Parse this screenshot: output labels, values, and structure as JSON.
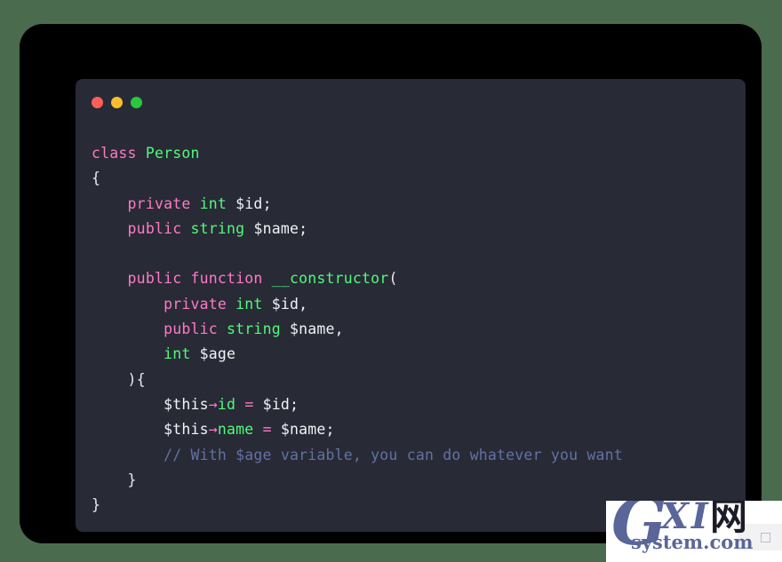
{
  "window": {
    "traffic_lights": [
      {
        "name": "close-button",
        "color": "#ff5f57"
      },
      {
        "name": "minimize-button",
        "color": "#febc2e"
      },
      {
        "name": "maximize-button",
        "color": "#28c840"
      }
    ]
  },
  "theme": {
    "page_background": "#4a6b4d",
    "frame_background": "#000000",
    "editor_background": "#282a36",
    "keyword": "#ff79c6",
    "type": "#50fa7b",
    "identifier": "#50fa7b",
    "plain": "#f2f3f7",
    "operator": "#ff79c6",
    "comment": "#6272a4"
  },
  "code": {
    "language": "php",
    "lines": [
      {
        "n": 1,
        "text": "class Person"
      },
      {
        "n": 2,
        "text": "{"
      },
      {
        "n": 3,
        "text": "    private int $id;"
      },
      {
        "n": 4,
        "text": "    public string $name;"
      },
      {
        "n": 5,
        "text": ""
      },
      {
        "n": 6,
        "text": "    public function __constructor("
      },
      {
        "n": 7,
        "text": "        private int $id,"
      },
      {
        "n": 8,
        "text": "        public string $name,"
      },
      {
        "n": 9,
        "text": "        int $age"
      },
      {
        "n": 10,
        "text": "    ){"
      },
      {
        "n": 11,
        "text": "        $this→id = $id;"
      },
      {
        "n": 12,
        "text": "        $this→name = $name;"
      },
      {
        "n": 13,
        "text": "        // With $age variable, you can do whatever you want"
      },
      {
        "n": 14,
        "text": "    }"
      },
      {
        "n": 15,
        "text": "}"
      }
    ]
  },
  "watermark": {
    "brand_letter": "G",
    "brand_xi": "XI",
    "brand_cjk": "网",
    "domain": "system.com"
  }
}
